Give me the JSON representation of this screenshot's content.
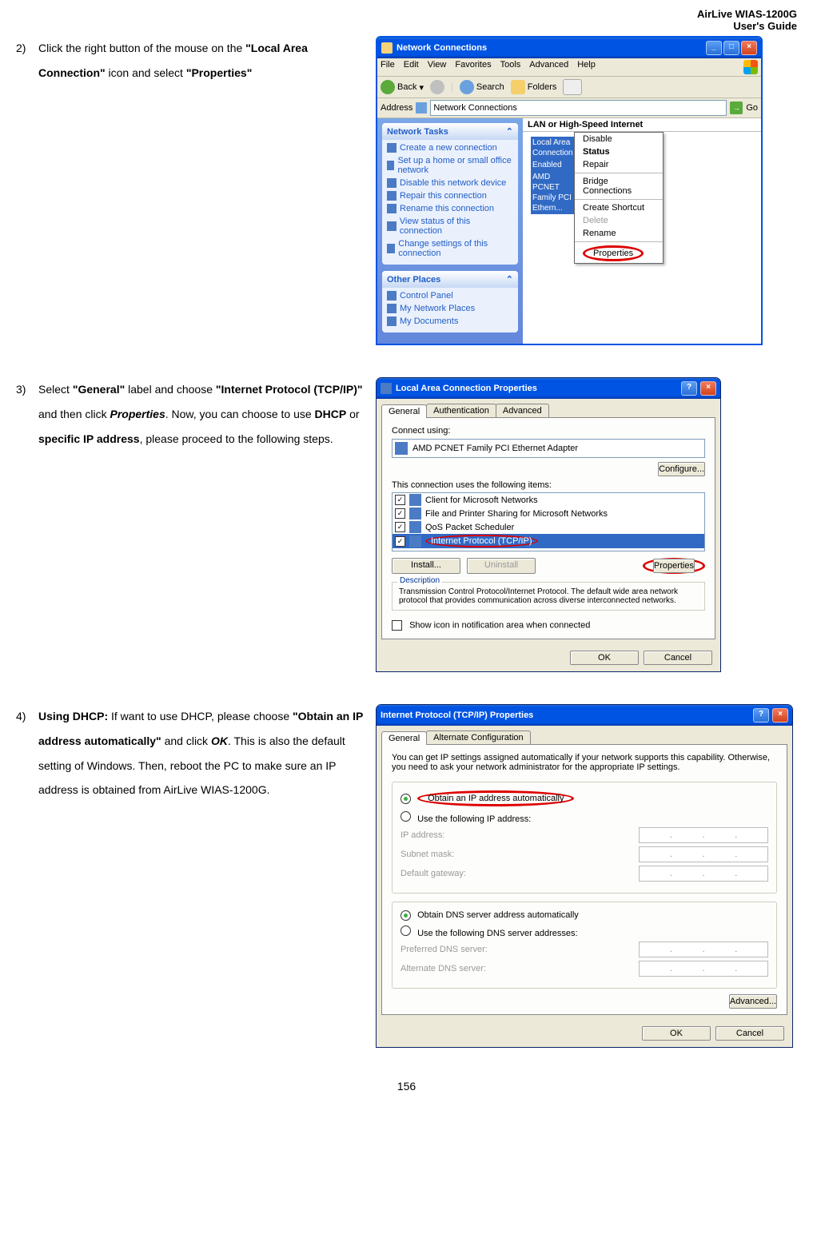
{
  "header": {
    "line1": "AirLive WIAS-1200G",
    "line2": "User's Guide"
  },
  "step2": {
    "num": "2)",
    "text_a": "Click the right button of the mouse on the ",
    "bold_a": "\"Local Area Connection\"",
    "text_b": " icon and select ",
    "bold_b": "\"Properties\""
  },
  "win1": {
    "title": "Network Connections",
    "menu": [
      "File",
      "Edit",
      "View",
      "Favorites",
      "Tools",
      "Advanced",
      "Help"
    ],
    "toolbar": {
      "back": "Back",
      "search": "Search",
      "folders": "Folders"
    },
    "addr_label": "Address",
    "addr_value": "Network Connections",
    "go": "Go",
    "panel1_title": "Network Tasks",
    "panel1_items": [
      "Create a new connection",
      "Set up a home or small office network",
      "Disable this network device",
      "Repair this connection",
      "Rename this connection",
      "View status of this connection",
      "Change settings of this connection"
    ],
    "panel2_title": "Other Places",
    "panel2_items": [
      "Control Panel",
      "My Network Places",
      "My Documents"
    ],
    "group_head": "LAN or High-Speed Internet",
    "conn_name": "Local Area Connection",
    "conn_status": "Enabled",
    "conn_dev": "AMD PCNET Family PCI Ethern...",
    "ctx": [
      "Disable",
      "Status",
      "Repair",
      "Bridge Connections",
      "Create Shortcut",
      "Delete",
      "Rename",
      "Properties"
    ]
  },
  "step3": {
    "num": "3)",
    "a": "Select ",
    "b": "\"General\"",
    "c": " label and choose ",
    "d": "\"Internet Protocol (TCP/IP)\"",
    "e": " and then click ",
    "f": "Properties",
    "g": ". Now, you can choose to use ",
    "h": "DHCP",
    "i": " or ",
    "j": "specific IP address",
    "k": ", please proceed to the following steps."
  },
  "win2": {
    "title": "Local Area Connection Properties",
    "tabs": [
      "General",
      "Authentication",
      "Advanced"
    ],
    "connect_using": "Connect using:",
    "adapter": "AMD PCNET Family PCI Ethernet Adapter",
    "configure": "Configure...",
    "uses_items": "This connection uses the following items:",
    "items": [
      "Client for Microsoft Networks",
      "File and Printer Sharing for Microsoft Networks",
      "QoS Packet Scheduler",
      "Internet Protocol (TCP/IP)"
    ],
    "install": "Install...",
    "uninstall": "Uninstall",
    "properties": "Properties",
    "desc_label": "Description",
    "desc_text": "Transmission Control Protocol/Internet Protocol. The default wide area network protocol that provides communication across diverse interconnected networks.",
    "show_icon": "Show icon in notification area when connected",
    "ok": "OK",
    "cancel": "Cancel"
  },
  "step4": {
    "num": "4)",
    "a": "Using DHCP:",
    "b": " If want to use DHCP, please choose ",
    "c": "\"Obtain an IP address automatically\"",
    "d": " and click ",
    "e": "OK",
    "f": ". This is also the default setting of Windows. Then, reboot the PC to make sure an IP address is obtained from AirLive WIAS-1200G."
  },
  "win3": {
    "title": "Internet Protocol (TCP/IP) Properties",
    "tabs": [
      "General",
      "Alternate Configuration"
    ],
    "intro": "You can get IP settings assigned automatically if your network supports this capability. Otherwise, you need to ask your network administrator for the appropriate IP settings.",
    "r1": "Obtain an IP address automatically",
    "r2": "Use the following IP address:",
    "ip_label": "IP address:",
    "mask_label": "Subnet mask:",
    "gw_label": "Default gateway:",
    "r3": "Obtain DNS server address automatically",
    "r4": "Use the following DNS server addresses:",
    "pdns": "Preferred DNS server:",
    "adns": "Alternate DNS server:",
    "advanced": "Advanced...",
    "ok": "OK",
    "cancel": "Cancel"
  },
  "page_number": "156"
}
